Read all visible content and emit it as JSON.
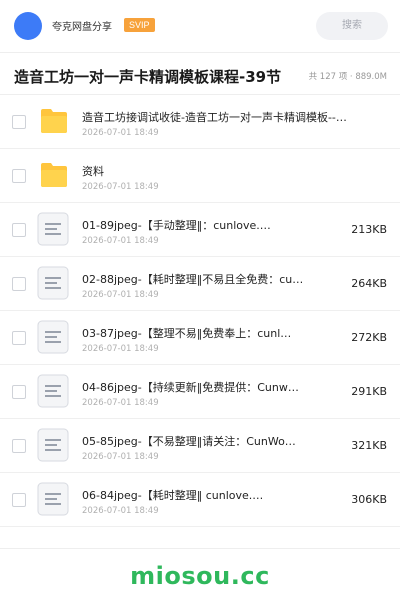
{
  "header": {
    "share_name": "夸克网盘分享",
    "badge": "SVIP",
    "search_label": "搜索"
  },
  "title_bar": {
    "title": "造音工坊一对一声卡精调模板课程-39节",
    "meta": "共 127 项 · 889.0M"
  },
  "items": [
    {
      "type": "folder",
      "name": "造音工坊接调试收徒-造音工坊一对一声卡精调模板--…",
      "date": "2026-07-01 18:49",
      "size": ""
    },
    {
      "type": "folder",
      "name": "资料",
      "date": "2026-07-01 18:49",
      "size": ""
    },
    {
      "type": "file",
      "name": "01-89jpeg-【手动整理‖：cunlove.…",
      "date": "2026-07-01 18:49",
      "size": "213KB"
    },
    {
      "type": "file",
      "name": "02-88jpeg-【耗时整理‖不易且全免费：cu…",
      "date": "2026-07-01 18:49",
      "size": "264KB"
    },
    {
      "type": "file",
      "name": "03-87jpeg-【整理不易‖免费奉上：cunl…",
      "date": "2026-07-01 18:49",
      "size": "272KB"
    },
    {
      "type": "file",
      "name": "04-86jpeg-【持续更新‖免费提供：Cunw…",
      "date": "2026-07-01 18:49",
      "size": "291KB"
    },
    {
      "type": "file",
      "name": "05-85jpeg-【不易整理‖请关注：CunWo…",
      "date": "2026-07-01 18:49",
      "size": "321KB"
    },
    {
      "type": "file",
      "name": "06-84jpeg-【耗时整理‖ cunlove.…",
      "date": "2026-07-01 18:49",
      "size": "306KB"
    }
  ],
  "watermark": "miosou.cc",
  "colors": {
    "avatar": "#3d7bf7",
    "svip_badge": "#f7a23b",
    "folder": "#ffc53d",
    "watermark": "#2fb85c"
  }
}
